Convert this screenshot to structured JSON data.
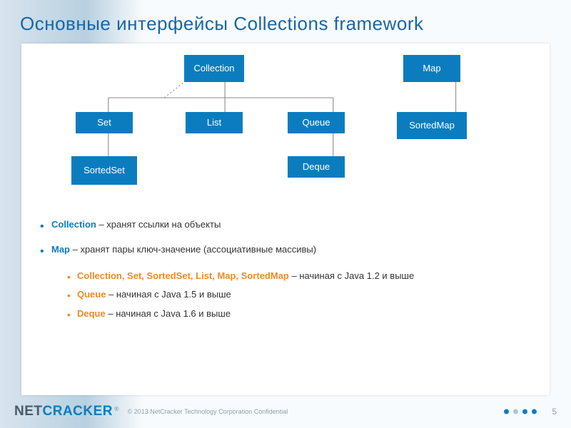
{
  "title": "Основные интерфейсы Collections framework",
  "diagram": {
    "collection": "Collection",
    "set": "Set",
    "list": "List",
    "queue": "Queue",
    "sortedset": "SortedSet",
    "deque": "Deque",
    "map": "Map",
    "sortedmap": "SortedMap"
  },
  "bullets": {
    "b1_kw": "Collection",
    "b1_txt": " – хранят ссылки на объекты",
    "b2_kw": "Map",
    "b2_txt": " – хранят пары ключ-значение (ассоциативные массивы)",
    "b3_kw": "Collection, Set, SortedSet, List, Map, SortedMap",
    "b3_txt": " – начиная с Java 1.2 и выше",
    "b4_kw": "Queue",
    "b4_txt": " – начиная с Java 1.5 и выше",
    "b5_kw": "Deque",
    "b5_txt": " – начиная с Java 1.6 и выше"
  },
  "footer": {
    "logo_net": "NET",
    "logo_cracker": "CRACKER",
    "reg": "®",
    "copyright": "© 2013 NetCracker Technology Corporation Confidential",
    "page": "5",
    "dot_colors": [
      "#0b7dbf",
      "#a9c7da",
      "#0b7dbf",
      "#0b7dbf"
    ]
  }
}
